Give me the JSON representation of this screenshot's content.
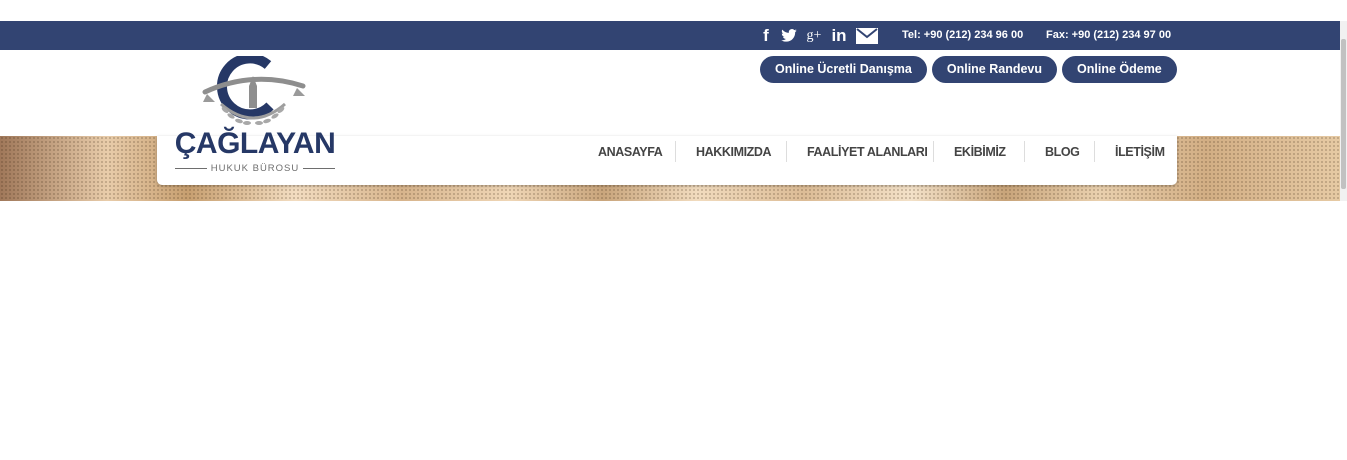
{
  "topbar": {
    "social": [
      "facebook-icon",
      "twitter-icon",
      "google-plus-icon",
      "linkedin-icon",
      "mail-icon"
    ],
    "tel": "Tel: +90 (212) 234 96 00",
    "fax": "Fax: +90 (212) 234 97 00"
  },
  "buttons": {
    "consult": "Online Ücretli Danışma",
    "appointment": "Online Randevu",
    "payment": "Online Ödeme"
  },
  "logo": {
    "title": "ÇAĞLAYAN",
    "subtitle": "HUKUK BÜROSU"
  },
  "nav": {
    "home": "ANASAYFA",
    "about": "HAKKIMIZDA",
    "practice": "FAALİYET ALANLARI",
    "team": "EKİBİMİZ",
    "blog": "BLOG",
    "contact": "İLETİŞİM"
  },
  "colors": {
    "brand": "#324472",
    "nav_text": "#444444"
  }
}
